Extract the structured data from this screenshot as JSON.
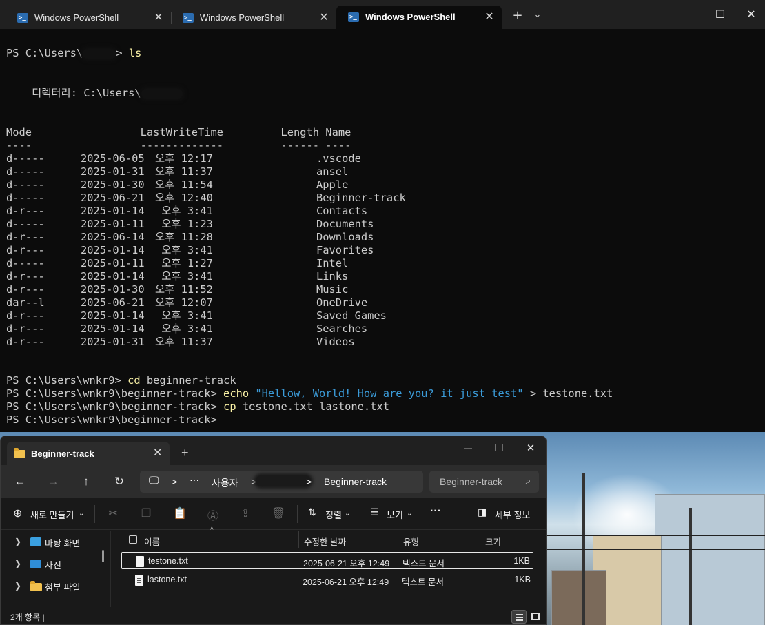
{
  "terminal": {
    "tabs": [
      {
        "title": "Windows PowerShell",
        "active": false
      },
      {
        "title": "Windows PowerShell",
        "active": false
      },
      {
        "title": "Windows PowerShell",
        "active": true
      }
    ],
    "tab_controls": {
      "new_tab": "+",
      "dropdown": "⌵"
    },
    "window_controls": {
      "minimize": "—",
      "maximize": "☐",
      "close": "✕"
    },
    "ls_prompt": "PS C:\\Users\\",
    "ls_prompt_tail": "> ",
    "ls_command": "ls",
    "directory_label": "    디렉터리: C:\\Users\\",
    "listing_header": "Mode                 LastWriteTime         Length Name",
    "listing_rule": "----                 -------------         ------ ----",
    "listing": [
      {
        "mode": "d-----",
        "date": "2025-06-05",
        "time": "오후 12:17",
        "name": ".vscode"
      },
      {
        "mode": "d-----",
        "date": "2025-01-31",
        "time": "오후 11:37",
        "name": "ansel"
      },
      {
        "mode": "d-----",
        "date": "2025-01-30",
        "time": "오후 11:54",
        "name": "Apple"
      },
      {
        "mode": "d-----",
        "date": "2025-06-21",
        "time": "오후 12:40",
        "name": "Beginner-track"
      },
      {
        "mode": "d-r---",
        "date": "2025-01-14",
        "time": " 오후 3:41",
        "name": "Contacts"
      },
      {
        "mode": "d-----",
        "date": "2025-01-11",
        "time": " 오후 1:23",
        "name": "Documents"
      },
      {
        "mode": "d-r---",
        "date": "2025-06-14",
        "time": "오후 11:28",
        "name": "Downloads"
      },
      {
        "mode": "d-r---",
        "date": "2025-01-14",
        "time": " 오후 3:41",
        "name": "Favorites"
      },
      {
        "mode": "d-----",
        "date": "2025-01-11",
        "time": " 오후 1:27",
        "name": "Intel"
      },
      {
        "mode": "d-r---",
        "date": "2025-01-14",
        "time": " 오후 3:41",
        "name": "Links"
      },
      {
        "mode": "d-r---",
        "date": "2025-01-30",
        "time": "오후 11:52",
        "name": "Music"
      },
      {
        "mode": "dar--l",
        "date": "2025-06-21",
        "time": "오후 12:07",
        "name": "OneDrive"
      },
      {
        "mode": "d-r---",
        "date": "2025-01-14",
        "time": " 오후 3:41",
        "name": "Saved Games"
      },
      {
        "mode": "d-r---",
        "date": "2025-01-14",
        "time": " 오후 3:41",
        "name": "Searches"
      },
      {
        "mode": "d-r---",
        "date": "2025-01-31",
        "time": "오후 11:37",
        "name": "Videos"
      }
    ],
    "history": [
      {
        "prompt": "PS C:\\Users\\wnkr9> ",
        "cmd": "cd",
        "args": " beginner-track"
      },
      {
        "prompt": "PS C:\\Users\\wnkr9\\beginner-track> ",
        "cmd": "echo",
        "string": " \"Hellow, World! How are you? it just test\"",
        "args": " > testone.txt"
      },
      {
        "prompt": "PS C:\\Users\\wnkr9\\beginner-track> ",
        "cmd": "cp",
        "args": " testone.txt lastone.txt"
      },
      {
        "prompt": "PS C:\\Users\\wnkr9\\beginner-track> ",
        "cmd": "",
        "args": ""
      }
    ]
  },
  "explorer": {
    "tab_title": "Beginner-track",
    "tab_close": "✕",
    "new_tab": "+",
    "window_controls": {
      "minimize": "—",
      "maximize": "☐",
      "close": "✕"
    },
    "nav": {
      "back": "←",
      "forward": "→",
      "up": "↑",
      "refresh": "↻"
    },
    "address": {
      "more": "···",
      "seg1": "사용자",
      "current": "Beginner-track",
      "sep": ">"
    },
    "search_placeholder": "Beginner-track",
    "commands": {
      "new": "새로 만들기",
      "sort": "정렬",
      "view": "보기",
      "more": "···",
      "details": "세부 정보"
    },
    "nav_pane": [
      {
        "label": "바탕 화면",
        "icon": "desktop-icon",
        "color": "#3ba0e0"
      },
      {
        "label": "사진",
        "icon": "pictures-icon",
        "color": "#2f8ed8"
      },
      {
        "label": "첨부 파일",
        "icon": "folder-icon",
        "color": "#f2c14e"
      }
    ],
    "columns": {
      "name": "이름",
      "modified": "수정한 날짜",
      "type": "유형",
      "size": "크기"
    },
    "files": [
      {
        "name": "testone.txt",
        "modified": "2025-06-21 오후 12:49",
        "type": "텍스트 문서",
        "size": "1KB",
        "selected": true
      },
      {
        "name": "lastone.txt",
        "modified": "2025-06-21 오후 12:49",
        "type": "텍스트 문서",
        "size": "1KB",
        "selected": false
      }
    ],
    "status": "2개 항목  |"
  }
}
